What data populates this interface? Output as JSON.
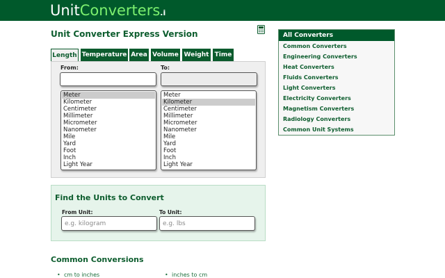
{
  "header": {
    "brand_unit": "Unit",
    "brand_converters": "Converters",
    "brand_suffix": ".i"
  },
  "page": {
    "title": "Unit Converter Express Version"
  },
  "tabs": [
    {
      "label": "Length",
      "active": true
    },
    {
      "label": "Temperature",
      "active": false
    },
    {
      "label": "Area",
      "active": false
    },
    {
      "label": "Volume",
      "active": false
    },
    {
      "label": "Weight",
      "active": false
    },
    {
      "label": "Time",
      "active": false
    }
  ],
  "converter": {
    "from_label": "From:",
    "to_label": "To:",
    "from_value": "",
    "to_value": "",
    "units": [
      "Meter",
      "Kilometer",
      "Centimeter",
      "Millimeter",
      "Micrometer",
      "Nanometer",
      "Mile",
      "Yard",
      "Foot",
      "Inch",
      "Light Year"
    ],
    "from_selected": "Meter",
    "to_selected": "Kilometer"
  },
  "find": {
    "title": "Find the Units to Convert",
    "from_label": "From Unit:",
    "to_label": "To Unit:",
    "from_placeholder": "e.g. kilogram",
    "to_placeholder": "e.g. lbs"
  },
  "common": {
    "title": "Common Conversions",
    "links": [
      "cm to inches",
      "inches to cm"
    ]
  },
  "sidebar": {
    "header": "All Converters",
    "items": [
      "Common Converters",
      "Engineering Converters",
      "Heat Converters",
      "Fluids Converters",
      "Light Converters",
      "Electricity Converters",
      "Magnetism Converters",
      "Radiology Converters",
      "Common Unit Systems"
    ]
  },
  "icons": {
    "calculator": "calculator-icon"
  },
  "colors": {
    "brand_green": "#00592b",
    "accent_green": "#7cf06f",
    "find_bg": "#e6f4eb"
  }
}
